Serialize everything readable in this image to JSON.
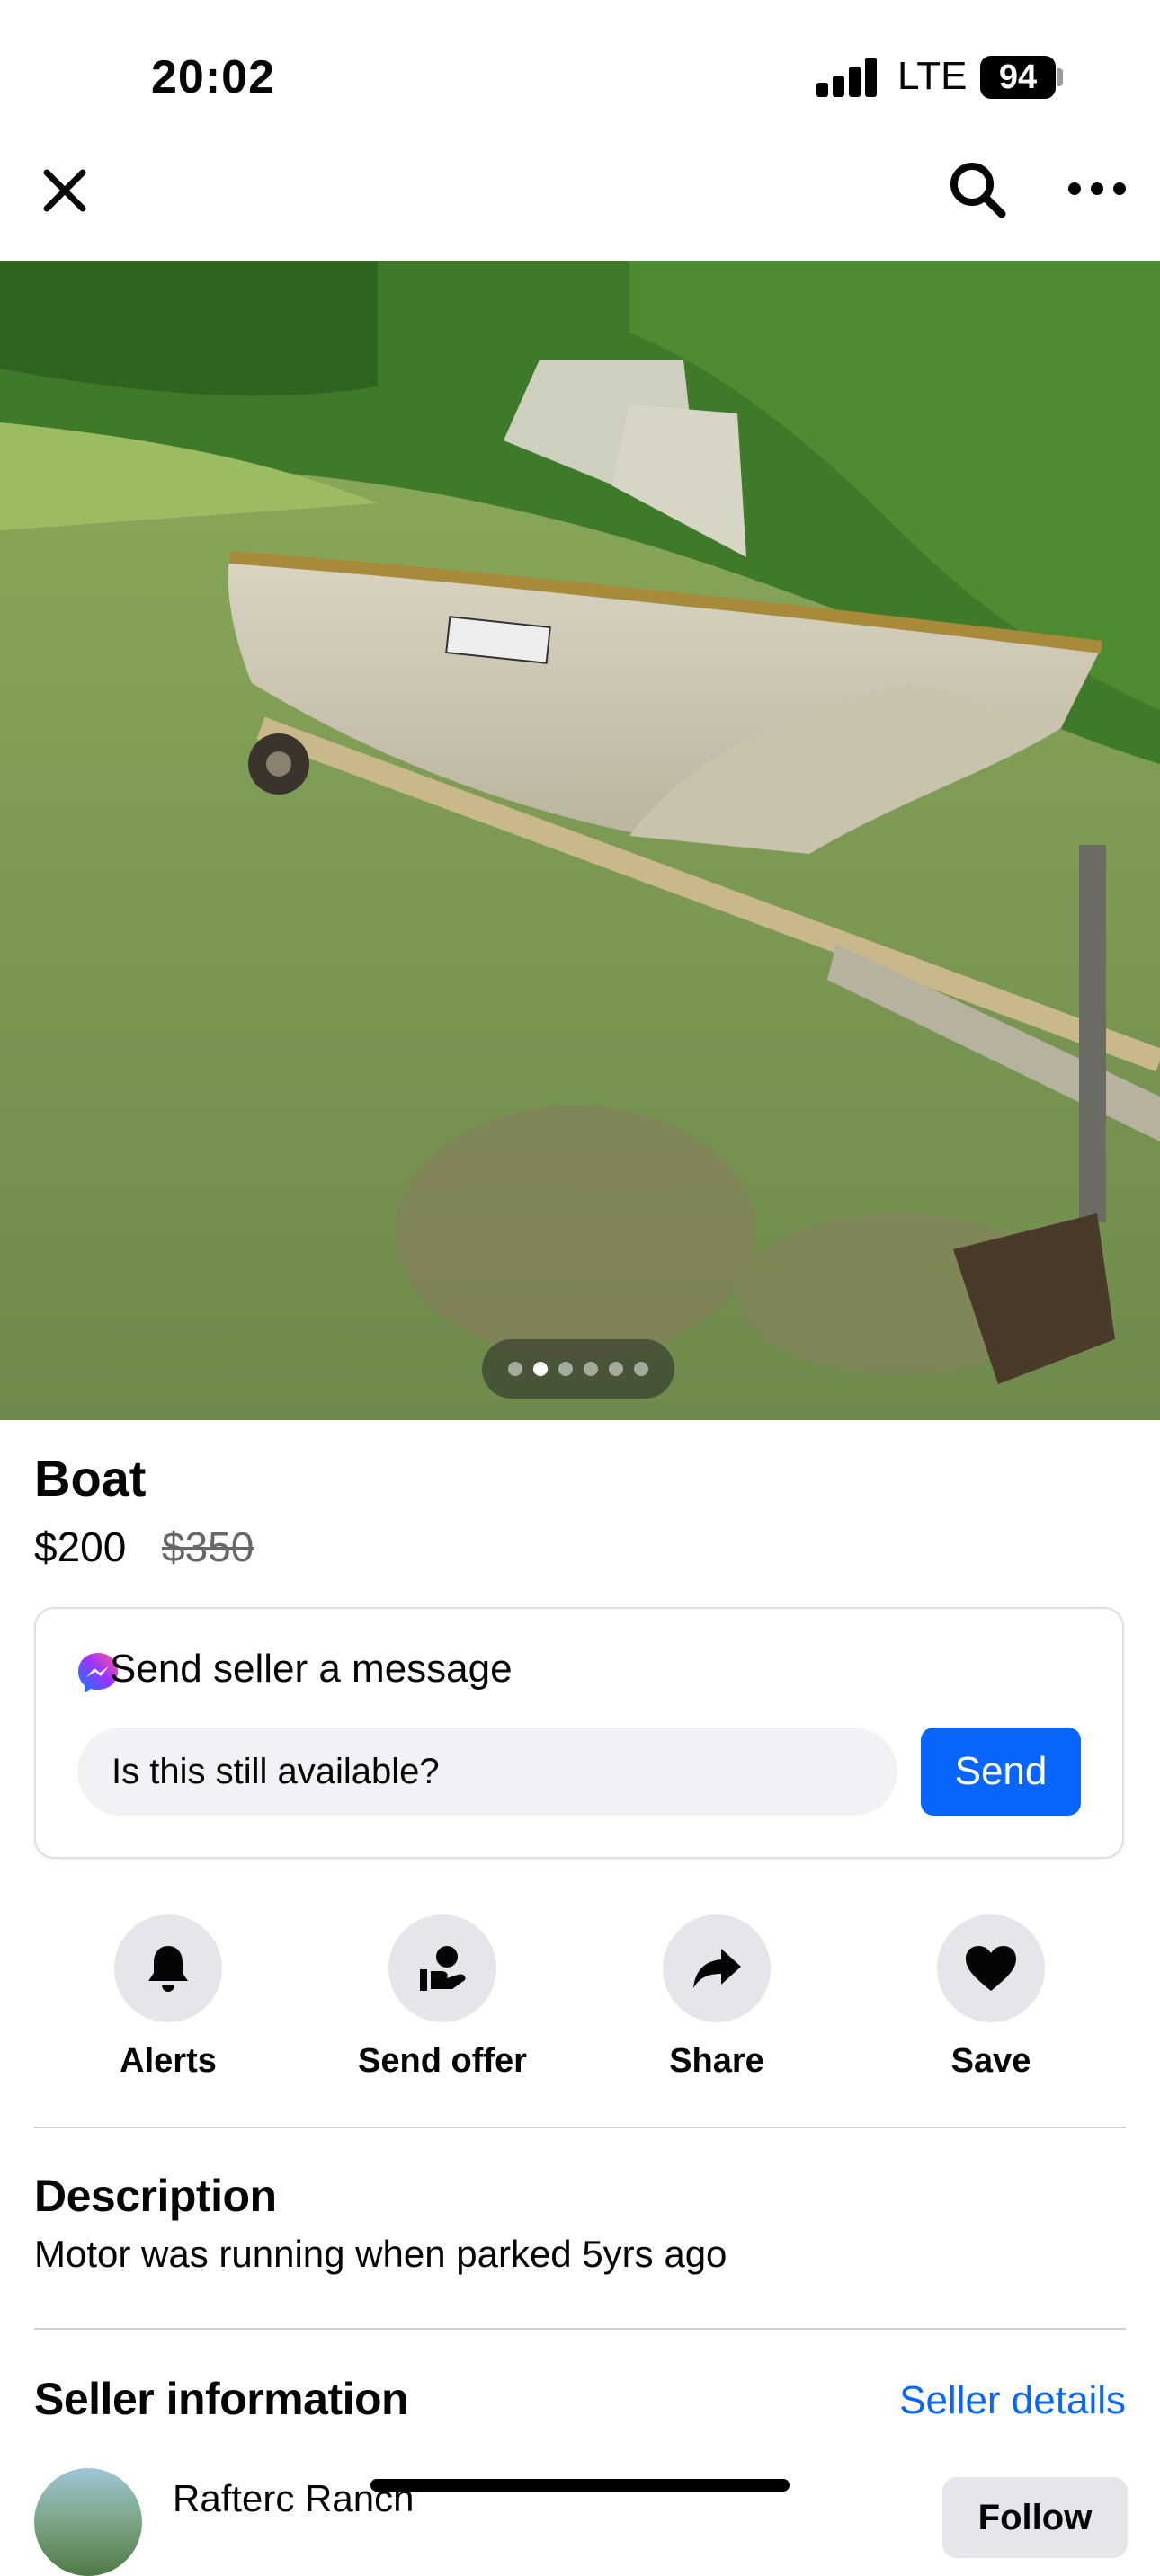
{
  "status_bar": {
    "time": "20:02",
    "network": "LTE",
    "battery": "94"
  },
  "nav": {
    "close_icon": "close-icon",
    "search_icon": "search-icon",
    "more_icon": "more-icon"
  },
  "gallery": {
    "photo_count": 6,
    "active_index": 1
  },
  "listing": {
    "title": "Boat",
    "price": "$200",
    "original_price": "$350"
  },
  "message": {
    "heading": "Send seller a message",
    "input_value": "Is this still available?",
    "send_label": "Send"
  },
  "actions": [
    {
      "label": "Alerts",
      "icon": "bell-icon"
    },
    {
      "label": "Send offer",
      "icon": "send-offer-icon"
    },
    {
      "label": "Share",
      "icon": "share-icon"
    },
    {
      "label": "Save",
      "icon": "heart-icon"
    }
  ],
  "description": {
    "heading": "Description",
    "text": "Motor was running when parked 5yrs ago"
  },
  "seller": {
    "heading": "Seller information",
    "details_link": "Seller details",
    "name": "Rafterc Ranch",
    "follow_label": "Follow"
  },
  "colors": {
    "accent": "#0866ff",
    "chip_bg": "#e4e6eb",
    "input_bg": "#f0f2f5"
  }
}
